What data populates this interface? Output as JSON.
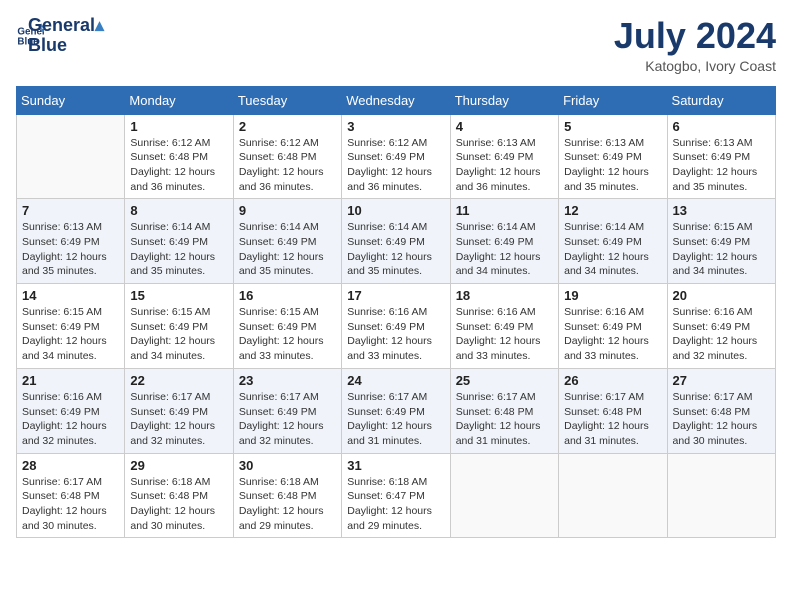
{
  "header": {
    "logo_line1": "General",
    "logo_line2": "Blue",
    "month": "July 2024",
    "location": "Katogbo, Ivory Coast"
  },
  "weekdays": [
    "Sunday",
    "Monday",
    "Tuesday",
    "Wednesday",
    "Thursday",
    "Friday",
    "Saturday"
  ],
  "weeks": [
    [
      {
        "day": "",
        "sunrise": "",
        "sunset": "",
        "daylight": ""
      },
      {
        "day": "1",
        "sunrise": "Sunrise: 6:12 AM",
        "sunset": "Sunset: 6:48 PM",
        "daylight": "Daylight: 12 hours and 36 minutes."
      },
      {
        "day": "2",
        "sunrise": "Sunrise: 6:12 AM",
        "sunset": "Sunset: 6:48 PM",
        "daylight": "Daylight: 12 hours and 36 minutes."
      },
      {
        "day": "3",
        "sunrise": "Sunrise: 6:12 AM",
        "sunset": "Sunset: 6:49 PM",
        "daylight": "Daylight: 12 hours and 36 minutes."
      },
      {
        "day": "4",
        "sunrise": "Sunrise: 6:13 AM",
        "sunset": "Sunset: 6:49 PM",
        "daylight": "Daylight: 12 hours and 36 minutes."
      },
      {
        "day": "5",
        "sunrise": "Sunrise: 6:13 AM",
        "sunset": "Sunset: 6:49 PM",
        "daylight": "Daylight: 12 hours and 35 minutes."
      },
      {
        "day": "6",
        "sunrise": "Sunrise: 6:13 AM",
        "sunset": "Sunset: 6:49 PM",
        "daylight": "Daylight: 12 hours and 35 minutes."
      }
    ],
    [
      {
        "day": "7",
        "sunrise": "Sunrise: 6:13 AM",
        "sunset": "Sunset: 6:49 PM",
        "daylight": "Daylight: 12 hours and 35 minutes."
      },
      {
        "day": "8",
        "sunrise": "Sunrise: 6:14 AM",
        "sunset": "Sunset: 6:49 PM",
        "daylight": "Daylight: 12 hours and 35 minutes."
      },
      {
        "day": "9",
        "sunrise": "Sunrise: 6:14 AM",
        "sunset": "Sunset: 6:49 PM",
        "daylight": "Daylight: 12 hours and 35 minutes."
      },
      {
        "day": "10",
        "sunrise": "Sunrise: 6:14 AM",
        "sunset": "Sunset: 6:49 PM",
        "daylight": "Daylight: 12 hours and 35 minutes."
      },
      {
        "day": "11",
        "sunrise": "Sunrise: 6:14 AM",
        "sunset": "Sunset: 6:49 PM",
        "daylight": "Daylight: 12 hours and 34 minutes."
      },
      {
        "day": "12",
        "sunrise": "Sunrise: 6:14 AM",
        "sunset": "Sunset: 6:49 PM",
        "daylight": "Daylight: 12 hours and 34 minutes."
      },
      {
        "day": "13",
        "sunrise": "Sunrise: 6:15 AM",
        "sunset": "Sunset: 6:49 PM",
        "daylight": "Daylight: 12 hours and 34 minutes."
      }
    ],
    [
      {
        "day": "14",
        "sunrise": "Sunrise: 6:15 AM",
        "sunset": "Sunset: 6:49 PM",
        "daylight": "Daylight: 12 hours and 34 minutes."
      },
      {
        "day": "15",
        "sunrise": "Sunrise: 6:15 AM",
        "sunset": "Sunset: 6:49 PM",
        "daylight": "Daylight: 12 hours and 34 minutes."
      },
      {
        "day": "16",
        "sunrise": "Sunrise: 6:15 AM",
        "sunset": "Sunset: 6:49 PM",
        "daylight": "Daylight: 12 hours and 33 minutes."
      },
      {
        "day": "17",
        "sunrise": "Sunrise: 6:16 AM",
        "sunset": "Sunset: 6:49 PM",
        "daylight": "Daylight: 12 hours and 33 minutes."
      },
      {
        "day": "18",
        "sunrise": "Sunrise: 6:16 AM",
        "sunset": "Sunset: 6:49 PM",
        "daylight": "Daylight: 12 hours and 33 minutes."
      },
      {
        "day": "19",
        "sunrise": "Sunrise: 6:16 AM",
        "sunset": "Sunset: 6:49 PM",
        "daylight": "Daylight: 12 hours and 33 minutes."
      },
      {
        "day": "20",
        "sunrise": "Sunrise: 6:16 AM",
        "sunset": "Sunset: 6:49 PM",
        "daylight": "Daylight: 12 hours and 32 minutes."
      }
    ],
    [
      {
        "day": "21",
        "sunrise": "Sunrise: 6:16 AM",
        "sunset": "Sunset: 6:49 PM",
        "daylight": "Daylight: 12 hours and 32 minutes."
      },
      {
        "day": "22",
        "sunrise": "Sunrise: 6:17 AM",
        "sunset": "Sunset: 6:49 PM",
        "daylight": "Daylight: 12 hours and 32 minutes."
      },
      {
        "day": "23",
        "sunrise": "Sunrise: 6:17 AM",
        "sunset": "Sunset: 6:49 PM",
        "daylight": "Daylight: 12 hours and 32 minutes."
      },
      {
        "day": "24",
        "sunrise": "Sunrise: 6:17 AM",
        "sunset": "Sunset: 6:49 PM",
        "daylight": "Daylight: 12 hours and 31 minutes."
      },
      {
        "day": "25",
        "sunrise": "Sunrise: 6:17 AM",
        "sunset": "Sunset: 6:48 PM",
        "daylight": "Daylight: 12 hours and 31 minutes."
      },
      {
        "day": "26",
        "sunrise": "Sunrise: 6:17 AM",
        "sunset": "Sunset: 6:48 PM",
        "daylight": "Daylight: 12 hours and 31 minutes."
      },
      {
        "day": "27",
        "sunrise": "Sunrise: 6:17 AM",
        "sunset": "Sunset: 6:48 PM",
        "daylight": "Daylight: 12 hours and 30 minutes."
      }
    ],
    [
      {
        "day": "28",
        "sunrise": "Sunrise: 6:17 AM",
        "sunset": "Sunset: 6:48 PM",
        "daylight": "Daylight: 12 hours and 30 minutes."
      },
      {
        "day": "29",
        "sunrise": "Sunrise: 6:18 AM",
        "sunset": "Sunset: 6:48 PM",
        "daylight": "Daylight: 12 hours and 30 minutes."
      },
      {
        "day": "30",
        "sunrise": "Sunrise: 6:18 AM",
        "sunset": "Sunset: 6:48 PM",
        "daylight": "Daylight: 12 hours and 29 minutes."
      },
      {
        "day": "31",
        "sunrise": "Sunrise: 6:18 AM",
        "sunset": "Sunset: 6:47 PM",
        "daylight": "Daylight: 12 hours and 29 minutes."
      },
      {
        "day": "",
        "sunrise": "",
        "sunset": "",
        "daylight": ""
      },
      {
        "day": "",
        "sunrise": "",
        "sunset": "",
        "daylight": ""
      },
      {
        "day": "",
        "sunrise": "",
        "sunset": "",
        "daylight": ""
      }
    ]
  ]
}
